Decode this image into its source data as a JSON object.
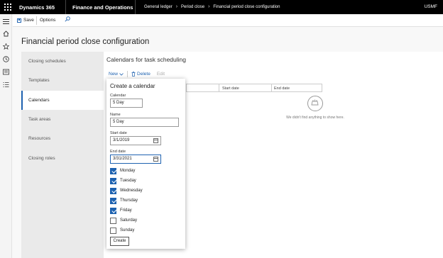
{
  "topbar": {
    "brand": "Dynamics 365",
    "app": "Finance and Operations",
    "breadcrumbs": [
      "General ledger",
      "Period close",
      "Financial period close configuration"
    ],
    "company": "USMF"
  },
  "rail": {
    "icons": [
      "hamburger-icon",
      "home-icon",
      "star-icon",
      "clock-icon",
      "modules-icon",
      "list-icon"
    ]
  },
  "actionpane": {
    "save_label": "Save",
    "options_label": "Options"
  },
  "page": {
    "title": "Financial period close configuration"
  },
  "tabs": [
    {
      "label": "Closing schedules"
    },
    {
      "label": "Templates"
    },
    {
      "label": "Calendars"
    },
    {
      "label": "Task areas"
    },
    {
      "label": "Resources"
    },
    {
      "label": "Closing roles"
    }
  ],
  "active_tab": "Calendars",
  "content": {
    "heading": "Calendars for task scheduling",
    "new_label": "New",
    "delete_label": "Delete",
    "edit_label": "Edit",
    "columns": [
      "Start date",
      "End date"
    ],
    "empty_text": "We didn't find anything to show here."
  },
  "flyout": {
    "title": "Create a calendar",
    "calendar_label": "Calendar",
    "calendar_value": "5 Day",
    "name_label": "Name",
    "name_value": "5 Day",
    "start_label": "Start date",
    "start_value": "3/1/2019",
    "end_label": "End date",
    "end_value": "3/31/2021",
    "days": [
      {
        "label": "Monday",
        "checked": true
      },
      {
        "label": "Tuesday",
        "checked": true
      },
      {
        "label": "Wednesday",
        "checked": true
      },
      {
        "label": "Thursday",
        "checked": true
      },
      {
        "label": "Friday",
        "checked": true
      },
      {
        "label": "Saturday",
        "checked": false
      },
      {
        "label": "Sunday",
        "checked": false
      }
    ],
    "create_label": "Create"
  },
  "colors": {
    "accent": "#1e62b0",
    "topbar": "#000000"
  }
}
